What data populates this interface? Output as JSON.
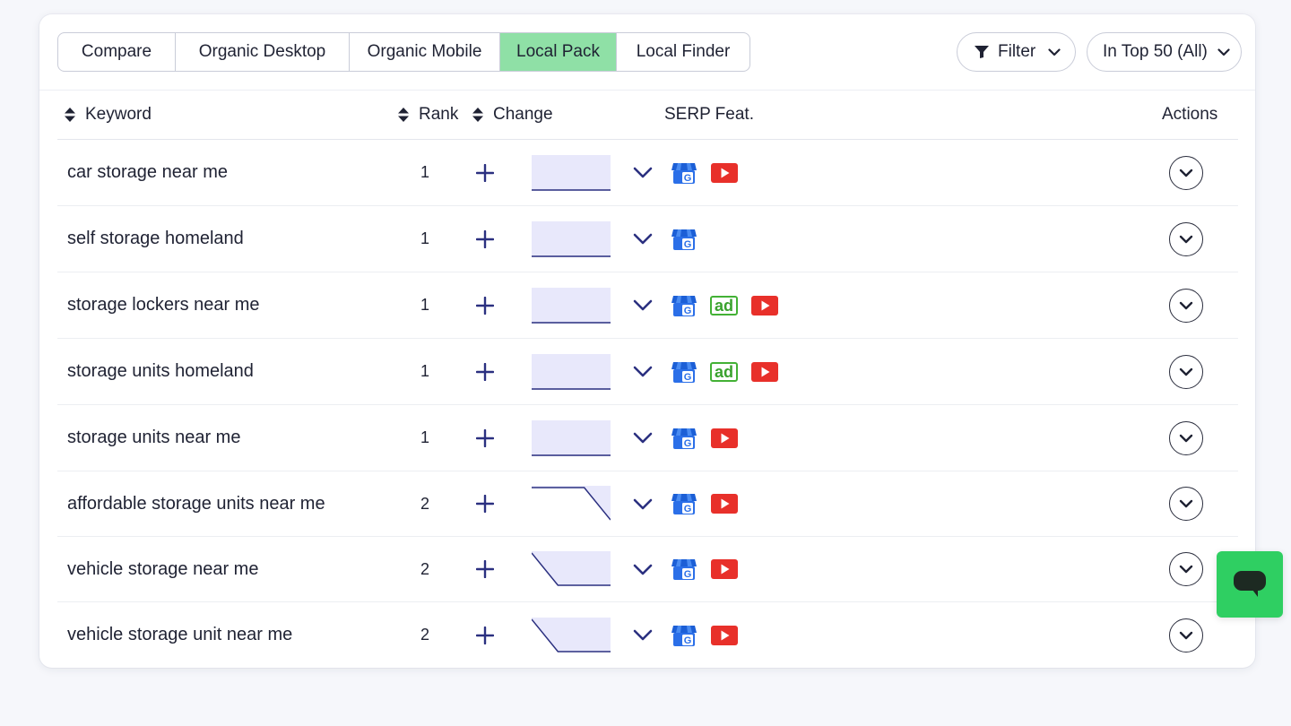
{
  "tabs": [
    {
      "label": "Compare",
      "active": false
    },
    {
      "label": "Organic Desktop",
      "active": false
    },
    {
      "label": "Organic Mobile",
      "active": false
    },
    {
      "label": "Local Pack",
      "active": true
    },
    {
      "label": "Local Finder",
      "active": false
    }
  ],
  "filter": {
    "label": "Filter",
    "icon": "funnel-icon"
  },
  "top_filter": {
    "label": "In Top 50 (All)"
  },
  "columns": {
    "keyword": "Keyword",
    "rank": "Rank",
    "change": "Change",
    "serp": "SERP Feat.",
    "actions": "Actions"
  },
  "feature_labels": {
    "ad": "ad"
  },
  "colors": {
    "active_tab": "#8fe0a6",
    "icon_navy": "#2b3080",
    "gmb_blue": "#2b6fe8",
    "youtube_red": "#e8302a",
    "ad_green": "#43b135",
    "chat_green": "#2fcf62"
  },
  "rows": [
    {
      "keyword": "car storage near me",
      "rank": "1",
      "trend": [
        1,
        1,
        1,
        1
      ],
      "features": [
        "google-my-business",
        "youtube"
      ]
    },
    {
      "keyword": "self storage homeland",
      "rank": "1",
      "trend": [
        1,
        1,
        1,
        1
      ],
      "features": [
        "google-my-business"
      ]
    },
    {
      "keyword": "storage lockers near me",
      "rank": "1",
      "trend": [
        1,
        1,
        1,
        1
      ],
      "features": [
        "google-my-business",
        "ad",
        "youtube"
      ]
    },
    {
      "keyword": "storage units homeland",
      "rank": "1",
      "trend": [
        1,
        1,
        1,
        1
      ],
      "features": [
        "google-my-business",
        "ad",
        "youtube"
      ]
    },
    {
      "keyword": "storage units near me",
      "rank": "1",
      "trend": [
        1,
        1,
        1,
        1
      ],
      "features": [
        "google-my-business",
        "youtube"
      ]
    },
    {
      "keyword": "affordable storage units near me",
      "rank": "2",
      "trend": [
        1,
        1,
        1,
        2
      ],
      "features": [
        "google-my-business",
        "youtube"
      ]
    },
    {
      "keyword": "vehicle storage near me",
      "rank": "2",
      "trend": [
        1,
        2,
        2,
        2
      ],
      "features": [
        "google-my-business",
        "youtube"
      ]
    },
    {
      "keyword": "vehicle storage unit near me",
      "rank": "2",
      "trend": [
        1,
        2,
        2,
        2
      ],
      "features": [
        "google-my-business",
        "youtube"
      ]
    }
  ]
}
